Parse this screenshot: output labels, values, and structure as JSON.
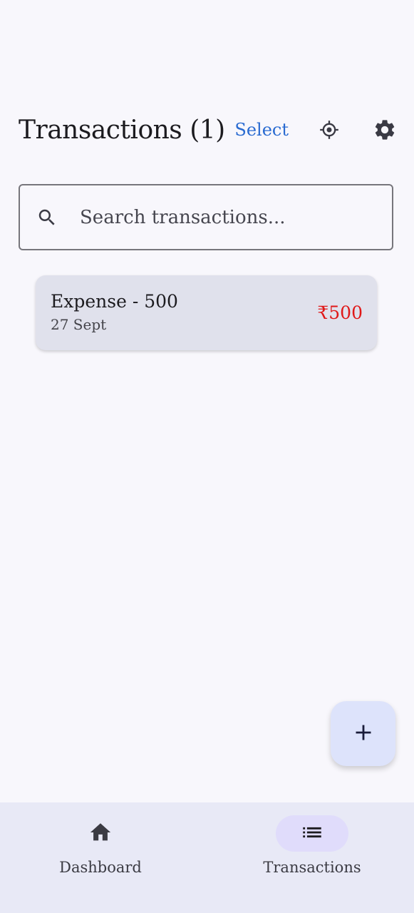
{
  "header": {
    "title": "Transactions (1)",
    "select_label": "Select",
    "target_icon": "target-icon",
    "settings_icon": "gear-icon"
  },
  "search": {
    "placeholder": "Search transactions...",
    "value": "",
    "icon": "search-icon"
  },
  "transactions": [
    {
      "title": "Expense - 500",
      "date": "27 Sept",
      "amount": "₹500",
      "amount_color": "#e01818"
    }
  ],
  "fab": {
    "icon": "plus-icon"
  },
  "bottom_nav": {
    "items": [
      {
        "label": "Dashboard",
        "icon": "home-icon",
        "active": false
      },
      {
        "label": "Transactions",
        "icon": "list-icon",
        "active": true
      }
    ]
  },
  "colors": {
    "background": "#f8f7fc",
    "accent": "#2a6bd1",
    "card": "#e0e1ec",
    "nav_bg": "#e8e9f6",
    "nav_active_pill": "#e0dcfb",
    "fab_bg": "#dde3fb",
    "expense": "#e01818"
  }
}
